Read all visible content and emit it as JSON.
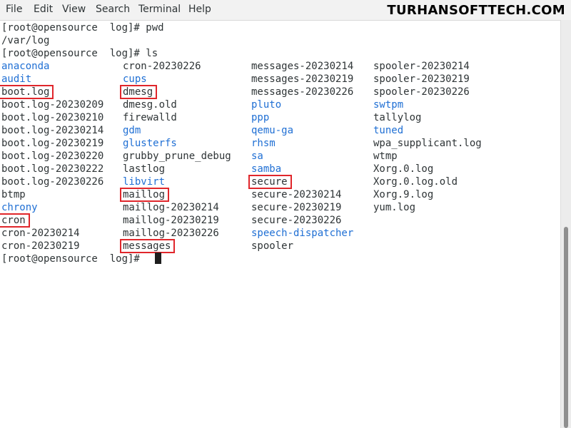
{
  "menubar": {
    "items": [
      "File",
      "Edit",
      "View",
      "Search",
      "Terminal",
      "Help"
    ]
  },
  "watermark": "TURHANSOFTTECH.COM",
  "terminal": {
    "lines": [
      "[root@opensource  log]# pwd",
      "/var/log",
      "[root@opensource  log]# ls"
    ],
    "prompt": "[root@opensource  log]#",
    "listing": {
      "columns": [
        [
          {
            "text": "anaconda",
            "color": "blue"
          },
          {
            "text": "audit",
            "color": "blue"
          },
          {
            "text": "boot.log",
            "color": "default",
            "highlight": true
          },
          {
            "text": "boot.log-20230209",
            "color": "default"
          },
          {
            "text": "boot.log-20230210",
            "color": "default"
          },
          {
            "text": "boot.log-20230214",
            "color": "default"
          },
          {
            "text": "boot.log-20230219",
            "color": "default"
          },
          {
            "text": "boot.log-20230220",
            "color": "default"
          },
          {
            "text": "boot.log-20230222",
            "color": "default"
          },
          {
            "text": "boot.log-20230226",
            "color": "default"
          },
          {
            "text": "btmp",
            "color": "default"
          },
          {
            "text": "chrony",
            "color": "blue"
          },
          {
            "text": "cron",
            "color": "default",
            "highlight": true
          },
          {
            "text": "cron-20230214",
            "color": "default"
          },
          {
            "text": "cron-20230219",
            "color": "default"
          }
        ],
        [
          {
            "text": "cron-20230226",
            "color": "default"
          },
          {
            "text": "cups",
            "color": "blue"
          },
          {
            "text": "dmesg",
            "color": "default",
            "highlight": true
          },
          {
            "text": "dmesg.old",
            "color": "default"
          },
          {
            "text": "firewalld",
            "color": "default"
          },
          {
            "text": "gdm",
            "color": "blue"
          },
          {
            "text": "glusterfs",
            "color": "blue"
          },
          {
            "text": "grubby_prune_debug",
            "color": "default"
          },
          {
            "text": "lastlog",
            "color": "default"
          },
          {
            "text": "libvirt",
            "color": "blue"
          },
          {
            "text": "maillog",
            "color": "default",
            "highlight": true
          },
          {
            "text": "maillog-20230214",
            "color": "default"
          },
          {
            "text": "maillog-20230219",
            "color": "default"
          },
          {
            "text": "maillog-20230226",
            "color": "default"
          },
          {
            "text": "messages",
            "color": "default",
            "highlight": true
          }
        ],
        [
          {
            "text": "messages-20230214",
            "color": "default"
          },
          {
            "text": "messages-20230219",
            "color": "default"
          },
          {
            "text": "messages-20230226",
            "color": "default"
          },
          {
            "text": "pluto",
            "color": "blue"
          },
          {
            "text": "ppp",
            "color": "blue"
          },
          {
            "text": "qemu-ga",
            "color": "blue"
          },
          {
            "text": "rhsm",
            "color": "blue"
          },
          {
            "text": "sa",
            "color": "blue"
          },
          {
            "text": "samba",
            "color": "blue"
          },
          {
            "text": "secure",
            "color": "default",
            "highlight": true
          },
          {
            "text": "secure-20230214",
            "color": "default"
          },
          {
            "text": "secure-20230219",
            "color": "default"
          },
          {
            "text": "secure-20230226",
            "color": "default"
          },
          {
            "text": "speech-dispatcher",
            "color": "blue"
          },
          {
            "text": "spooler",
            "color": "default"
          }
        ],
        [
          {
            "text": "spooler-20230214",
            "color": "default"
          },
          {
            "text": "spooler-20230219",
            "color": "default"
          },
          {
            "text": "spooler-20230226",
            "color": "default"
          },
          {
            "text": "swtpm",
            "color": "blue"
          },
          {
            "text": "tallylog",
            "color": "default"
          },
          {
            "text": "tuned",
            "color": "blue"
          },
          {
            "text": "wpa_supplicant.log",
            "color": "default"
          },
          {
            "text": "wtmp",
            "color": "default"
          },
          {
            "text": "Xorg.0.log",
            "color": "default"
          },
          {
            "text": "Xorg.0.log.old",
            "color": "default"
          },
          {
            "text": "Xorg.9.log",
            "color": "default"
          },
          {
            "text": "yum.log",
            "color": "default"
          }
        ]
      ]
    }
  },
  "colors": {
    "text": "#2e3436",
    "directory": "#1f6fd4",
    "highlight_box": "#e0262b",
    "background": "#ffffff"
  }
}
